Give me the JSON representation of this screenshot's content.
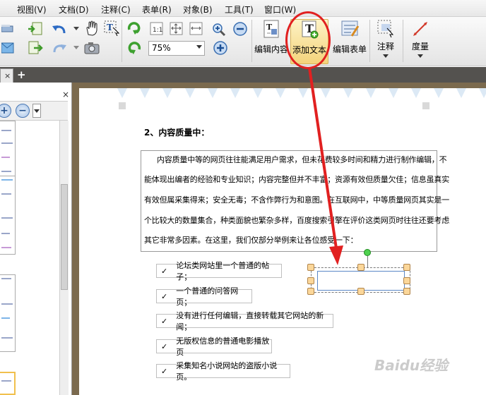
{
  "menu": [
    "视图(V)",
    "文档(D)",
    "注释(C)",
    "表单(R)",
    "对象(B)",
    "工具(T)",
    "窗口(W)"
  ],
  "toolbar": {
    "zoom_value": "75%",
    "edit_content_label": "编辑内容",
    "add_text_label": "添加文本",
    "edit_form_label": "编辑表单",
    "annotate_label": "注释",
    "measure_label": "度量",
    "accent_color": "#e12020"
  },
  "tab": {
    "close": "×",
    "add": "+"
  },
  "side": {
    "close": "×"
  },
  "doc": {
    "heading": "2、内容质量中：",
    "paragraph": [
      "内容质量中等的网页往往能满足用户需求，但未花费较多时间和精力进行制作编辑，不",
      "能体现出编者的经验和专业知识；内容完整但并不丰富；资源有效但质量欠佳；信息虽真实",
      "有效但属采集得来；安全无毒；不含作弊行为和意图。在互联网中，中等质量网页其实是一",
      "个比较大的数量集合，种类面貌也繁杂多样，百度搜索引擎在评价这类网页时往往还要考虑",
      "其它非常多因素。在这里，我们仅部分举例来让各位感受一下："
    ],
    "checks": [
      "论坛类网站里一个普通的帖子；",
      "一个普通的问答网页；",
      "没有进行任何编辑，直接转载其它网站的新闻；",
      "无版权信息的普通电影播放页",
      "采集知名小说网站的盗版小说页。"
    ],
    "check_mark": "✓"
  },
  "watermark": "Baidu经验"
}
